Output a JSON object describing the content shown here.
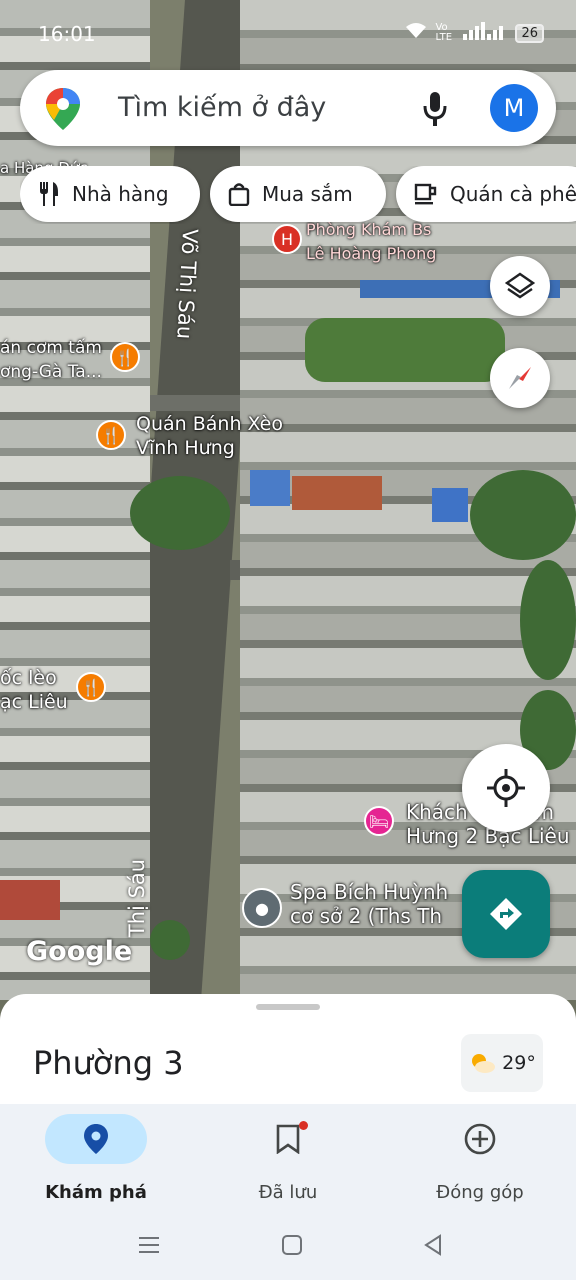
{
  "status_bar": {
    "time": "16:01",
    "signal": "Vo LTE",
    "battery": "26"
  },
  "search": {
    "placeholder": "Tìm kiếm ở đây",
    "avatar_letter": "M"
  },
  "chips": [
    {
      "label": "Nhà hàng",
      "icon": "fork-knife-icon"
    },
    {
      "label": "Mua sắm",
      "icon": "shopping-bag-icon"
    },
    {
      "label": "Quán cà phê",
      "icon": "coffee-icon"
    }
  ],
  "map": {
    "places": [
      {
        "name": "Phòng Khám Bs\nLê Hoàng Phong",
        "type": "hospital"
      },
      {
        "name": "án cơm tấm\nơng-Gà Ta...",
        "type": "restaurant"
      },
      {
        "name": "Quán Bánh Xèo\nVĩnh Hưng",
        "type": "restaurant"
      },
      {
        "name": "ốc lèo\nạc Liêu",
        "type": "restaurant"
      },
      {
        "name": "Khách sạn Kim\nHưng 2 Bạc Liêu",
        "type": "hotel"
      },
      {
        "name": "Spa Bích Huỳnh\ncơ sở 2 (Ths Th",
        "type": "place"
      },
      {
        "name": "a Hàng Đức",
        "type": "label"
      }
    ],
    "streets": [
      "Võ Thị Sáu",
      "Thị Sáu"
    ],
    "attribution": "Google"
  },
  "sheet": {
    "title": "Phường 3",
    "temperature": "29°"
  },
  "bottom_nav": [
    {
      "label": "Khám phá",
      "icon": "location-pin-icon",
      "active": true
    },
    {
      "label": "Đã lưu",
      "icon": "bookmark-icon",
      "active": false
    },
    {
      "label": "Đóng góp",
      "icon": "add-circle-icon",
      "active": false
    }
  ],
  "colors": {
    "accent": "#1a73e8",
    "nav_active_bg": "#c2e7ff",
    "directions_fab": "#0b7d7a",
    "place_marker": "#f57c00"
  }
}
